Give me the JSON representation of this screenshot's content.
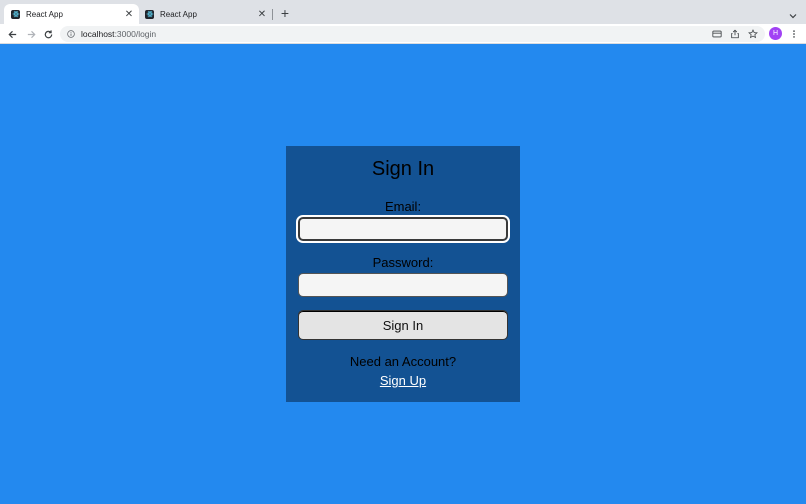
{
  "browser": {
    "tabs": [
      {
        "title": "React App",
        "active": true
      },
      {
        "title": "React App",
        "active": false
      }
    ],
    "url_host": "localhost",
    "url_path": ":3000/login",
    "profile_initial": "H",
    "colors": {
      "tabstrip": "#dee1e6",
      "avatar": "#a142f4"
    }
  },
  "page": {
    "background": "#2389ef",
    "card_color": "#135293",
    "title": "Sign In",
    "email_label": "Email:",
    "email_value": "",
    "password_label": "Password:",
    "password_value": "",
    "submit_label": "Sign In",
    "need_account": "Need an Account?",
    "signup_link": "Sign Up"
  }
}
